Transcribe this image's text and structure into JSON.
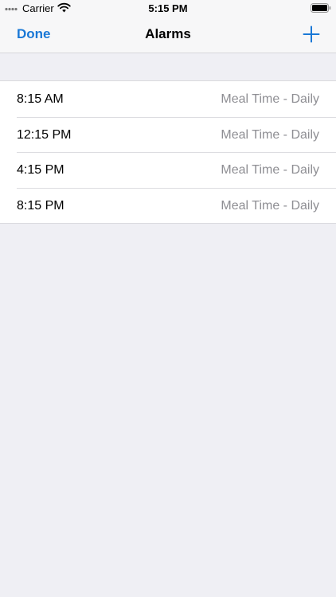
{
  "status_bar": {
    "carrier": "Carrier",
    "time": "5:15 PM"
  },
  "nav": {
    "left_button": "Done",
    "title": "Alarms",
    "right_icon": "plus-icon"
  },
  "alarms": [
    {
      "time": "8:15 AM",
      "description": "Meal Time - Daily"
    },
    {
      "time": "12:15 PM",
      "description": "Meal Time - Daily"
    },
    {
      "time": "4:15 PM",
      "description": "Meal Time - Daily"
    },
    {
      "time": "8:15 PM",
      "description": "Meal Time - Daily"
    }
  ],
  "colors": {
    "accent": "#1a78d6",
    "background": "#efeff4",
    "secondary_text": "#8e8e93"
  }
}
